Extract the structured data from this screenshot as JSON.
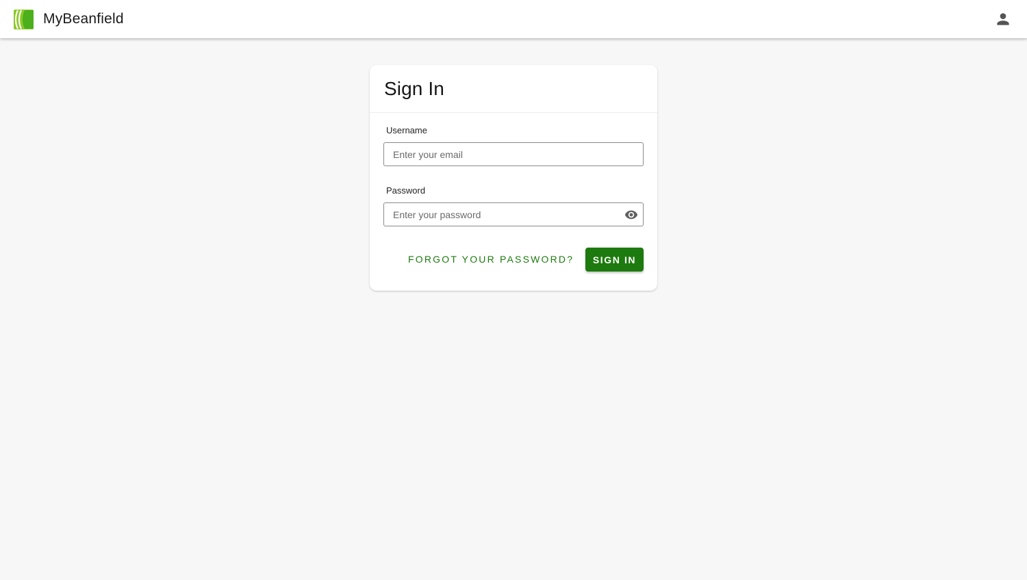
{
  "app": {
    "brand_name": "MyBeanfield",
    "logo_icon": "beanfield-logo-icon",
    "account_icon": "person-icon"
  },
  "colors": {
    "brand_green": "#1d7a0e",
    "logo_green_light": "#8ac926",
    "logo_green_dark": "#4caf1c",
    "background": "#f7f7f7"
  },
  "signin_card": {
    "title": "Sign In",
    "username": {
      "label": "Username",
      "placeholder": "Enter your email",
      "value": ""
    },
    "password": {
      "label": "Password",
      "placeholder": "Enter your password",
      "value": "",
      "toggle_icon": "eye-icon"
    },
    "forgot_link": "FORGOT YOUR PASSWORD?",
    "submit_label": "SIGN IN"
  }
}
